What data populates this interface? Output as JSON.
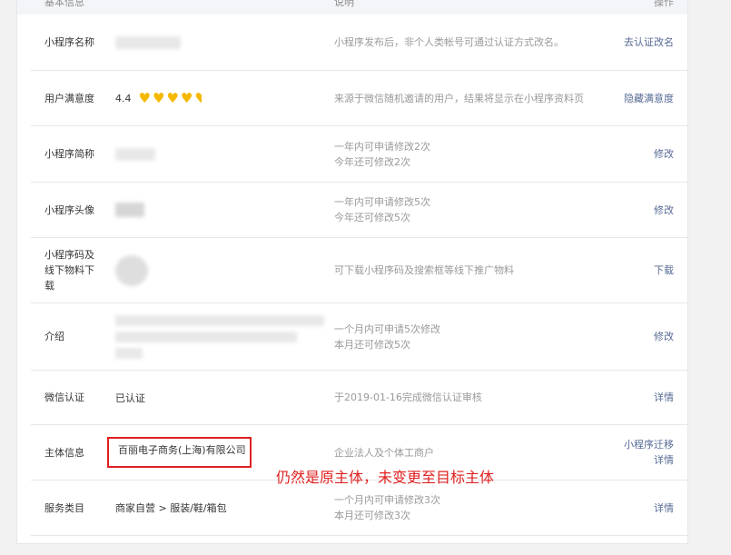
{
  "table": {
    "headers": {
      "info": "基本信息",
      "desc": "说明",
      "op": "操作"
    },
    "rows": [
      {
        "label": "小程序名称",
        "value": "",
        "desc": [
          "小程序发布后，非个人类帐号可通过认证方式改名。"
        ],
        "ops": [
          "去认证改名"
        ]
      },
      {
        "label": "用户满意度",
        "value": "4.4",
        "desc": [
          "来源于微信随机邀请的用户，结果将显示在小程序资料页"
        ],
        "ops": [
          "隐藏满意度"
        ]
      },
      {
        "label": "小程序简称",
        "value": "",
        "desc": [
          "一年内可申请修改2次",
          "今年还可修改2次"
        ],
        "ops": [
          "修改"
        ]
      },
      {
        "label": "小程序头像",
        "value": "",
        "desc": [
          "一年内可申请修改5次",
          "今年还可修改5次"
        ],
        "ops": [
          "修改"
        ]
      },
      {
        "label": "小程序码及线下物料下载",
        "value": "",
        "desc": [
          "可下载小程序码及搜索框等线下推广物料"
        ],
        "ops": [
          "下载"
        ]
      },
      {
        "label": "介绍",
        "value": "",
        "desc": [
          "一个月内可申请5次修改",
          "本月还可修改5次"
        ],
        "ops": [
          "修改"
        ]
      },
      {
        "label": "微信认证",
        "value": "已认证",
        "desc": [
          "于2019-01-16完成微信认证审核"
        ],
        "ops": [
          "详情"
        ]
      },
      {
        "label": "主体信息",
        "value": "百丽电子商务(上海)有限公司",
        "desc": [
          "企业法人及个体工商户"
        ],
        "ops": [
          "小程序迁移",
          "详情"
        ]
      },
      {
        "label": "服务类目",
        "value": "商家自营 > 服装/鞋/箱包",
        "desc": [
          "一个月内可申请修改3次",
          "本月还可修改3次"
        ],
        "ops": [
          "详情"
        ]
      }
    ]
  },
  "rating": {
    "hearts": 5,
    "filled": 4.4,
    "color": "#f5b800"
  },
  "annotation": {
    "text": "仍然是原主体，未变更至目标主体",
    "color": "#e02020"
  },
  "colors": {
    "link": "#576b95",
    "muted": "#9a9a9a",
    "border": "#e7e7eb"
  }
}
